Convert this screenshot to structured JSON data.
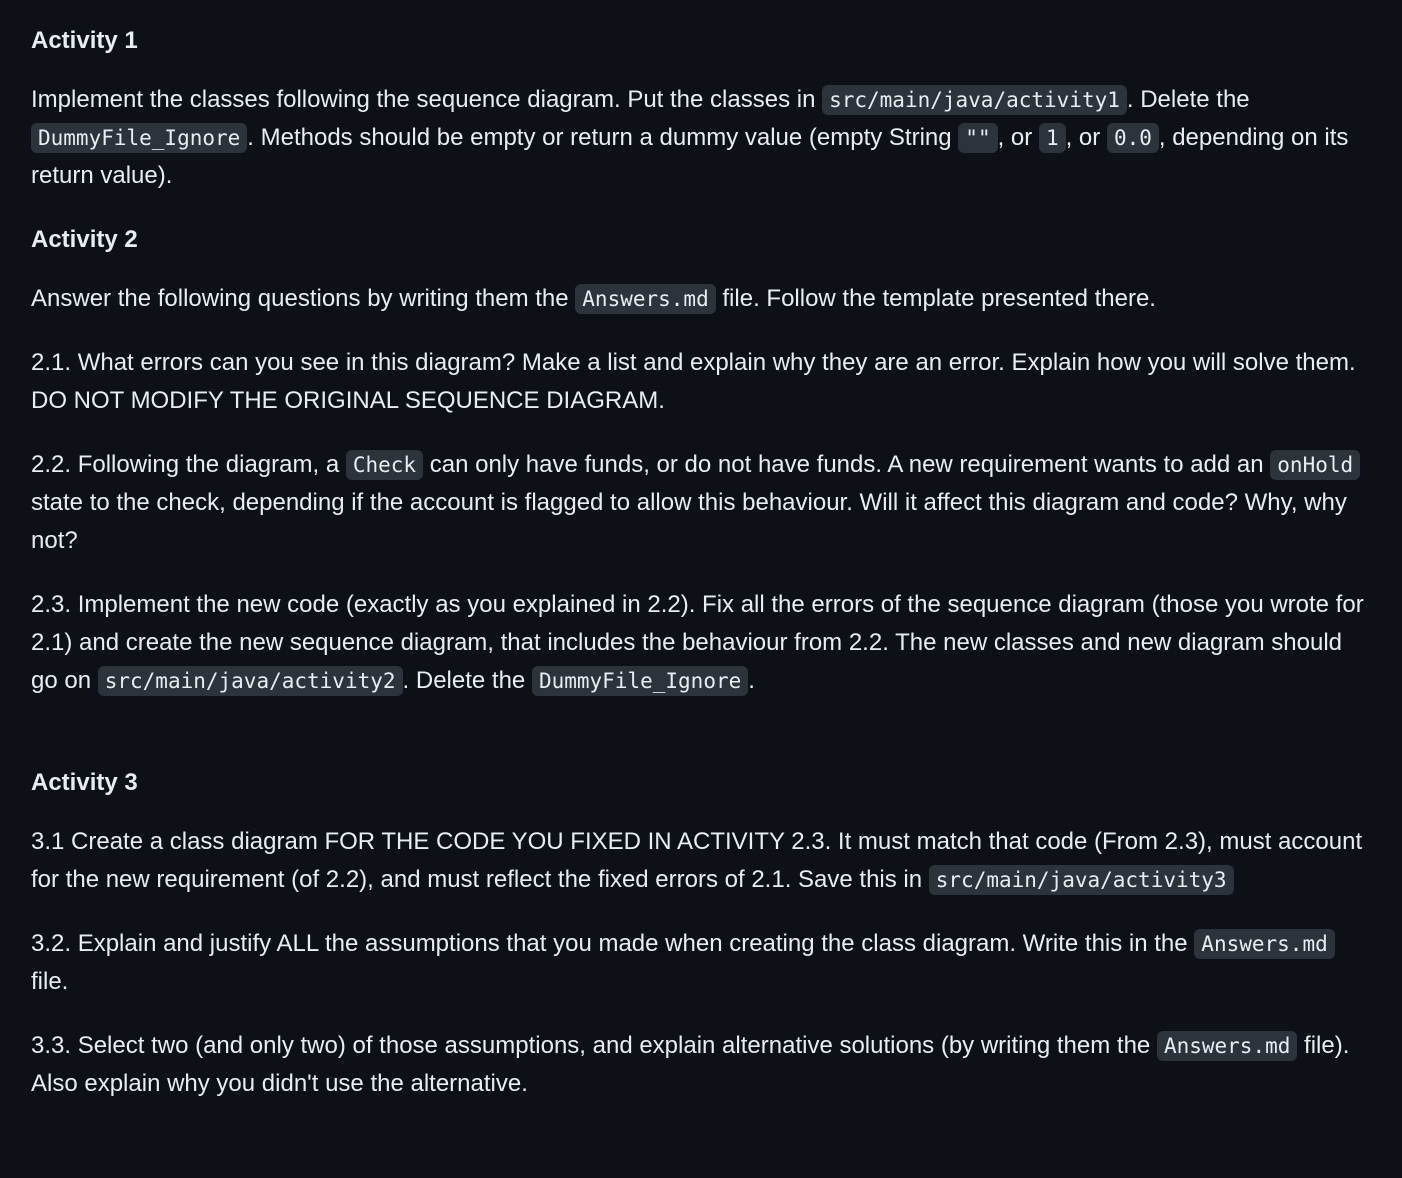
{
  "activity1": {
    "heading": "Activity 1",
    "p1": {
      "t1": "Implement the classes following the sequence diagram. Put the classes in ",
      "c1": "src/main/java/activity1",
      "t2": ". Delete the ",
      "c2": "DummyFile_Ignore",
      "t3": ". Methods should be empty or return a dummy value (empty String ",
      "c3": "\"\"",
      "t4": ", or ",
      "c4": "1",
      "t5": ", or ",
      "c5": "0.0",
      "t6": ", depending on its return value)."
    }
  },
  "activity2": {
    "heading": "Activity 2",
    "intro": {
      "t1": "Answer the following questions by writing them the ",
      "c1": "Answers.md",
      "t2": " file. Follow the template presented there."
    },
    "q21": "2.1. What errors can you see in this diagram? Make a list and explain why they are an error. Explain how you will solve them. DO NOT MODIFY THE ORIGINAL SEQUENCE DIAGRAM.",
    "q22": {
      "t1": "2.2. Following the diagram, a ",
      "c1": "Check",
      "t2": " can only have funds, or do not have funds. A new requirement wants to add an ",
      "c2": "onHold",
      "t3": " state to the check, depending if the account is flagged to allow this behaviour. Will it affect this diagram and code? Why, why not?"
    },
    "q23": {
      "t1": "2.3. Implement the new code (exactly as you explained in 2.2). Fix all the errors of the sequence diagram (those you wrote for 2.1) and create the new sequence diagram, that includes the behaviour from 2.2. The new classes and new diagram should go on ",
      "c1": "src/main/java/activity2",
      "t2": ". Delete the ",
      "c2": "DummyFile_Ignore",
      "t3": "."
    }
  },
  "activity3": {
    "heading": "Activity 3",
    "q31": {
      "t1": "3.1 Create a class diagram FOR THE CODE YOU FIXED IN ACTIVITY 2.3. It must match that code (From 2.3), must account for the new requirement (of 2.2), and must reflect the fixed errors of 2.1. Save this in ",
      "c1": "src/main/java/activity3"
    },
    "q32": {
      "t1": "3.2. Explain and justify ALL the assumptions that you made when creating the class diagram. Write this in the ",
      "c1": "Answers.md",
      "t2": " file."
    },
    "q33": {
      "t1": "3.3. Select two (and only two) of those assumptions, and explain alternative solutions (by writing them the ",
      "c1": "Answers.md",
      "t2": " file). Also explain why you didn't use the alternative."
    }
  }
}
